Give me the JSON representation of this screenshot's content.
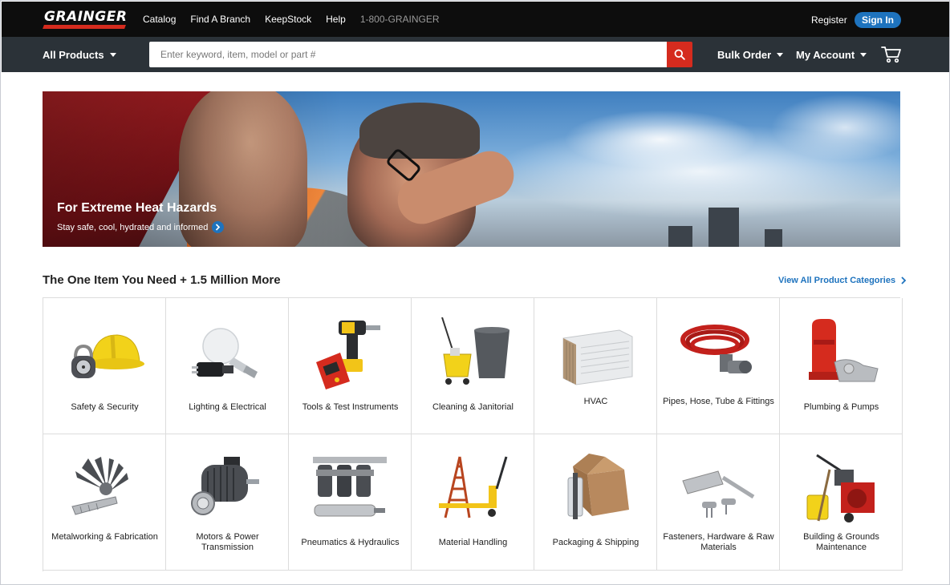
{
  "header": {
    "logo_text": "GRAINGER",
    "top_links": [
      "Catalog",
      "Find A Branch",
      "KeepStock",
      "Help"
    ],
    "phone": "1-800-GRAINGER",
    "register_label": "Register",
    "signin_label": "Sign In"
  },
  "nav": {
    "all_products_label": "All Products",
    "search_placeholder": "Enter keyword, item, model or part #",
    "bulk_order_label": "Bulk Order",
    "my_account_label": "My Account"
  },
  "hero": {
    "title": "For Extreme Heat Hazards",
    "subtitle": "Stay safe, cool, hydrated and informed"
  },
  "categories_section": {
    "title": "The One Item You Need + 1.5 Million More",
    "view_all_label": "View All Product Categories",
    "items": [
      {
        "label": "Safety & Security",
        "icon": "hard-hat-icon"
      },
      {
        "label": "Lighting & Electrical",
        "icon": "light-bulb-icon"
      },
      {
        "label": "Tools & Test Instruments",
        "icon": "drill-icon"
      },
      {
        "label": "Cleaning & Janitorial",
        "icon": "mop-bucket-icon"
      },
      {
        "label": "HVAC",
        "icon": "air-conditioner-icon"
      },
      {
        "label": "Pipes, Hose, Tube & Fittings",
        "icon": "hose-icon"
      },
      {
        "label": "Plumbing & Pumps",
        "icon": "pump-icon"
      },
      {
        "label": "Metalworking & Fabrication",
        "icon": "flap-disc-icon"
      },
      {
        "label": "Motors & Power Transmission",
        "icon": "motor-icon"
      },
      {
        "label": "Pneumatics & Hydraulics",
        "icon": "filter-regulator-icon"
      },
      {
        "label": "Material Handling",
        "icon": "pallet-jack-icon"
      },
      {
        "label": "Packaging & Shipping",
        "icon": "box-icon"
      },
      {
        "label": "Fasteners, Hardware & Raw Materials",
        "icon": "door-closer-icon"
      },
      {
        "label": "Building & Grounds Maintenance",
        "icon": "snow-blower-icon"
      }
    ]
  },
  "colors": {
    "brand_red": "#d52b1e",
    "link_blue": "#1e73be",
    "top_bar": "#0d0d0d",
    "nav_bar": "#2b3238"
  }
}
